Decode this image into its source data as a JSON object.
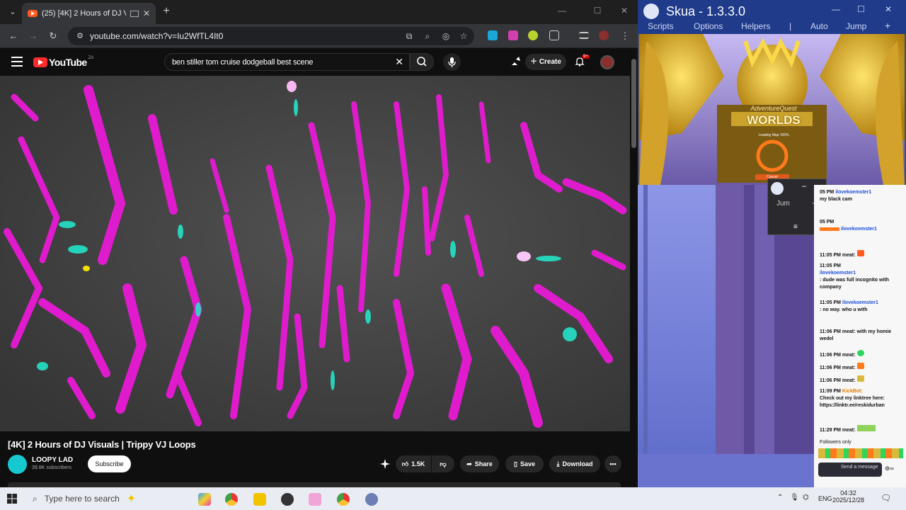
{
  "browser": {
    "tab_title": "(25) [4K] 2 Hours of DJ Visu",
    "url": "youtube.com/watch?v=Iu2WfTL4It0",
    "window_controls": [
      "minimize",
      "maximize",
      "close"
    ]
  },
  "youtube": {
    "logo_text": "YouTube",
    "logo_region": "ZA",
    "search_query": "ben stiller tom cruise dodgeball best scene",
    "create_label": "Create",
    "notification_count": "9+",
    "video_title": "[4K] 2 Hours of DJ Visuals | Trippy VJ Loops",
    "channel_name": "LOOPY LAD",
    "channel_subs": "39.8K subscribers",
    "subscribe_label": "Subscribe",
    "like_count": "1.5K",
    "share_label": "Share",
    "save_label": "Save",
    "download_label": "Download"
  },
  "skua": {
    "title": "Skua - 1.3.3.0",
    "menu": [
      "Scripts",
      "Options",
      "Helpers",
      "|",
      "Auto",
      "Jump",
      "+"
    ],
    "game_title_line1": "AdventureQuest",
    "game_title_line2": "WORLDS",
    "loading_text": "Loading Map   100%",
    "cancel_label": "Cancel",
    "mini_label": "Jum",
    "mini_minus": "–",
    "mini_plus": "+"
  },
  "chat": {
    "messages": [
      {
        "time": "05 PM",
        "user": "ilovekoemster1",
        "text": "my black cam"
      },
      {
        "time": "05 PM",
        "user": "ilovekoemster1",
        "text": ""
      },
      {
        "time": "11:05 PM",
        "user": "meat:",
        "text": ""
      },
      {
        "time": "11:05 PM",
        "user": "ilovekoemster1",
        "text": ": dude was full incognito with company"
      },
      {
        "time": "11:05 PM",
        "user": "ilovekoemster1",
        "text": ": no way. who u with"
      },
      {
        "time": "11:06 PM",
        "user": "meat:",
        "text": "with my homie wedel"
      },
      {
        "time": "11:06 PM",
        "user": "meat:",
        "text": ""
      },
      {
        "time": "11:06 PM",
        "user": "meat:",
        "text": ""
      },
      {
        "time": "11:06 PM",
        "user": "meat:",
        "text": ""
      },
      {
        "time": "11:09 PM",
        "user": "KickBot:",
        "text": "Check out my linktree here: https://linktr.ee/reskidurban"
      },
      {
        "time": "11:29 PM",
        "user": "meat:",
        "text": ""
      }
    ],
    "followers_only": "Followers only",
    "send_placeholder": "Send a message"
  },
  "taskbar": {
    "search_placeholder": "Type here to search",
    "language": "ENG",
    "time": "04:32",
    "date": "2025/12/28"
  },
  "colors": {
    "chrome_bg": "#0f0f0f",
    "skua_bar": "#1f3b8a",
    "visual_magenta": "#e81ad5",
    "visual_cyan": "#23e3c8"
  }
}
